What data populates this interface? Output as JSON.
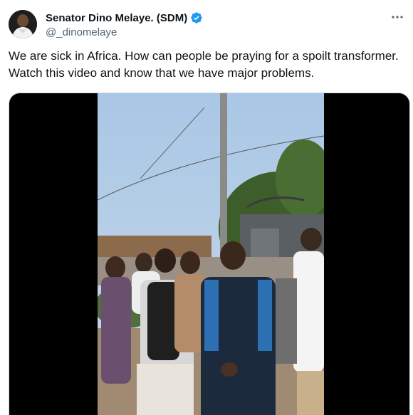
{
  "author": {
    "display_name": "Senator Dino Melaye. (SDM)",
    "handle": "@_dinomelaye",
    "verified_badge_color": "#1d9bf0"
  },
  "icons": {
    "verified": "verified-badge-icon",
    "more": "more-options-icon"
  },
  "tweet": {
    "text": "We are sick in Africa. How can people be praying for a spoilt transformer.\nWatch this video and know that we have major problems."
  },
  "colors": {
    "text_primary": "#0f1419",
    "text_secondary": "#536471",
    "media_background": "#000000"
  }
}
